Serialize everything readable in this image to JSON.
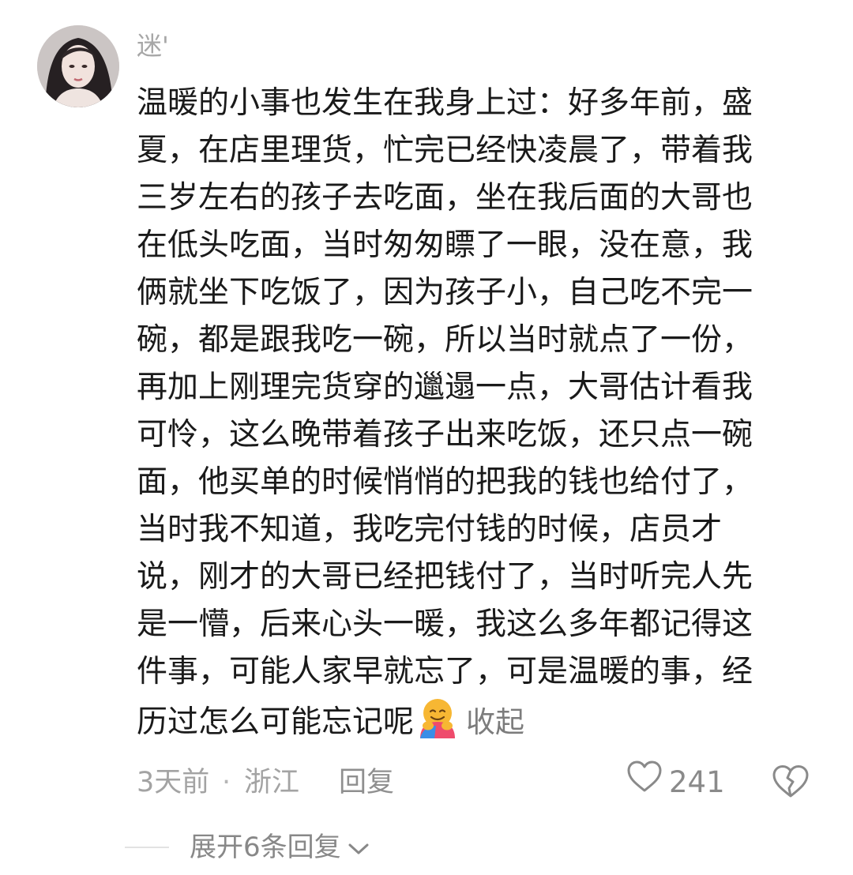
{
  "comment": {
    "username": "迷'",
    "avatar_icon": "user-avatar",
    "body_lines": [
      "温暖的小事也发生在我身上过：好多年前，盛",
      "夏，在店里理货，忙完已经快凌晨了，带着我",
      "三岁左右的孩子去吃面，坐在我后面的大哥也",
      "在低头吃面，当时匆匆瞟了一眼，没在意，我",
      "俩就坐下吃饭了，因为孩子小，自己吃不完一",
      "碗，都是跟我吃一碗，所以当时就点了一份，",
      "再加上刚理完货穿的邋遢一点，大哥估计看我",
      "可怜，这么晚带着孩子出来吃饭，还只点一碗",
      "面，他买单的时候悄悄的把我的钱也给付了，",
      "当时我不知道，我吃完付钱的时候，店员才",
      "说，刚才的大哥已经把钱付了，当时听完人先",
      "是一懵，后来心头一暖，我这么多年都记得这",
      "件事，可能人家早就忘了，可是温暖的事，经"
    ],
    "last_line": "历过怎么可能忘记呢",
    "emoji_icon": "hugging-face-emoji",
    "collapse_label": "收起",
    "time": "3天前",
    "separator": "·",
    "location": "浙江",
    "reply_label": "回复",
    "like_icon": "heart-outline-icon",
    "like_count": "241",
    "dislike_icon": "broken-heart-icon",
    "expand_label": "展开6条回复",
    "expand_icon": "chevron-down-icon"
  },
  "colors": {
    "text_primary": "#1a1a1a",
    "text_secondary": "#a3a3a3",
    "link_gray": "#7c7c7c",
    "icon_gray": "#8a8a8a",
    "divider": "#e2e2e2",
    "emoji_yellow": "#f7b733",
    "emoji_pink": "#ef4b6c",
    "emoji_blue": "#3a8ee6"
  }
}
